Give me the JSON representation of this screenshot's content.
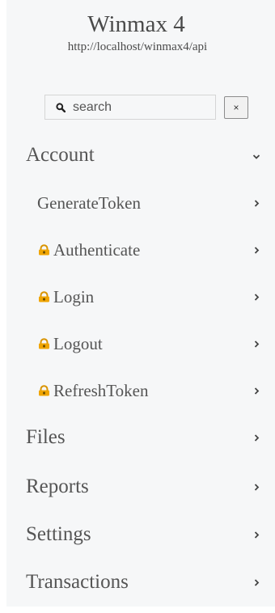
{
  "header": {
    "title": "Winmax 4",
    "url": "http://localhost/winmax4/api"
  },
  "search": {
    "placeholder": "search",
    "value": "",
    "clear_label": "×"
  },
  "nav": {
    "account": {
      "label": "Account",
      "expanded": true,
      "items": [
        {
          "label": "GenerateToken",
          "locked": false
        },
        {
          "label": "Authenticate",
          "locked": true
        },
        {
          "label": "Login",
          "locked": true
        },
        {
          "label": "Logout",
          "locked": true
        },
        {
          "label": "RefreshToken",
          "locked": true
        }
      ]
    },
    "groups": [
      {
        "label": "Files"
      },
      {
        "label": "Reports"
      },
      {
        "label": "Settings"
      },
      {
        "label": "Transactions"
      }
    ]
  },
  "icons": {
    "search": "search-icon",
    "lock": "lock-icon",
    "chevron_down": "chevron-down-icon",
    "chevron_right": "chevron-right-icon"
  },
  "colors": {
    "sidebar_bg": "#f6f7f8",
    "text": "#555555",
    "lock": "#f0a500"
  }
}
